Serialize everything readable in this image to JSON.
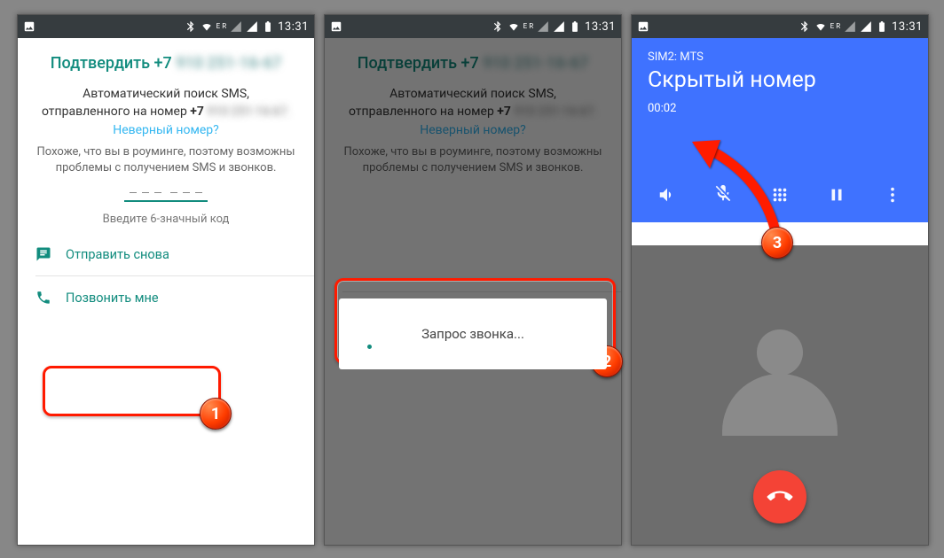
{
  "status": {
    "time": "13:31",
    "er": "E R"
  },
  "verify": {
    "title_prefix": "Подтвердить +7",
    "title_blur": "910 251-16-67",
    "desc_main": "Автоматический поиск SMS,",
    "desc_line2_prefix": "отправленного на номер ",
    "desc_line2_bold": "+7",
    "desc_line2_blur": "910 251-16-67.",
    "wrong_number": "Неверный номер?",
    "roaming": "Похоже, что вы в роуминге, поэтому возможны проблемы с получением SMS и звонков.",
    "hint": "Введите 6-значный код",
    "resend": "Отправить снова",
    "call_me": "Позвонить мне"
  },
  "dialog": {
    "text": "Запрос звонка..."
  },
  "call": {
    "sim": "SIM2: MTS",
    "caller": "Скрытый номер",
    "timer": "00:02"
  },
  "markers": {
    "b1": "1",
    "b2": "2",
    "b3": "3"
  }
}
